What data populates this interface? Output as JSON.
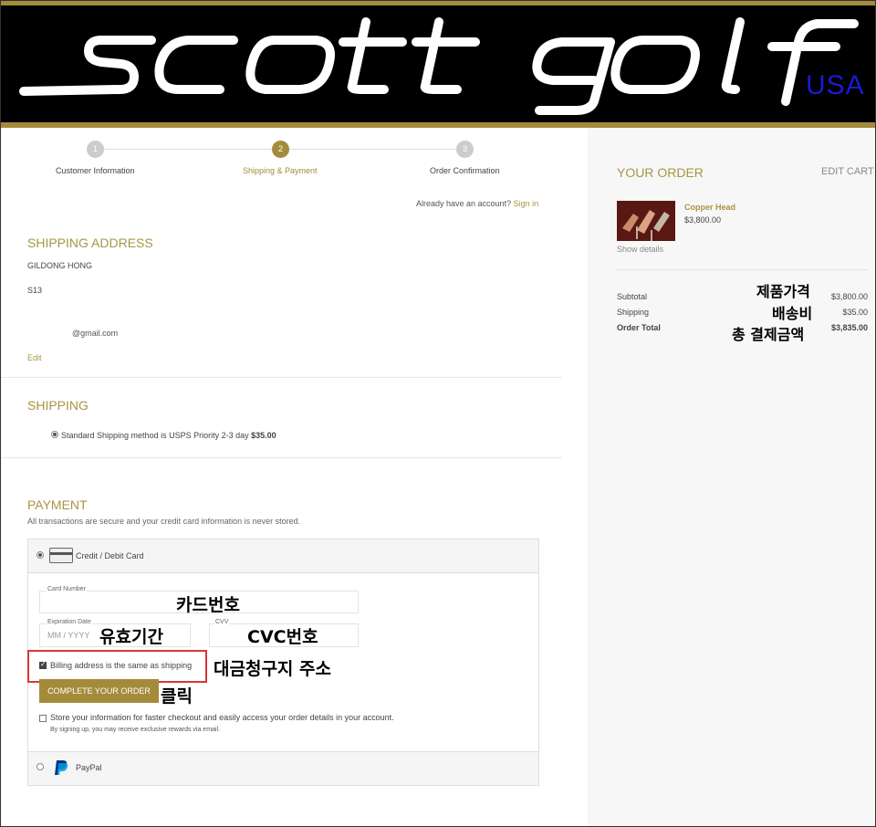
{
  "header": {
    "logo_text": "scott golf",
    "logo_suffix": "USA"
  },
  "steps": [
    {
      "num": "1",
      "label": "Customer Information"
    },
    {
      "num": "2",
      "label": "Shipping & Payment"
    },
    {
      "num": "3",
      "label": "Order Confirmation"
    }
  ],
  "account": {
    "prompt": "Already have an account?",
    "signin": "Sign in"
  },
  "shipping_address": {
    "title": "SHIPPING ADDRESS",
    "name": "GILDONG HONG",
    "line1": "S13",
    "email": "@gmail.com",
    "edit": "Edit"
  },
  "shipping": {
    "title": "SHIPPING",
    "method_text": "Standard Shipping method is USPS Priority 2-3 day",
    "method_price": "$35.00"
  },
  "payment": {
    "title": "PAYMENT",
    "subtitle": "All transactions are secure and your credit card information is never stored.",
    "credit_label": "Credit / Debit Card",
    "card_number_label": "Card Number",
    "expiration_label": "Expiration Date",
    "expiration_placeholder": "MM / YYYY",
    "cvv_label": "CVV",
    "billing_same": "Billing address is the same as shipping",
    "complete_button": "COMPLETE YOUR ORDER",
    "store_info": "Store your information for faster checkout and easily access your order details in your account.",
    "store_note": "By signing up, you may receive exclusive rewards via email.",
    "paypal_label": "PayPal"
  },
  "order": {
    "title": "YOUR ORDER",
    "edit_cart": "EDIT CART",
    "product_name": "Copper Head",
    "product_price": "$3,800.00",
    "show_details": "Show details",
    "subtotal_label": "Subtotal",
    "subtotal_value": "$3,800.00",
    "shipping_label": "Shipping",
    "shipping_value": "$35.00",
    "total_label": "Order Total",
    "total_value": "$3,835.00"
  },
  "annotations": {
    "product_price": "제품가격",
    "shipping_cost": "배송비",
    "total_payment": "총 결제금액",
    "card_number": "카드번호",
    "expiry": "유효기간",
    "cvc": "CVC번호",
    "billing_address": "대금청구지 주소",
    "click": "클릭"
  },
  "colors": {
    "gold": "#a48b3b",
    "usa_blue": "#1a1ad0",
    "highlight_red": "#d93636"
  }
}
